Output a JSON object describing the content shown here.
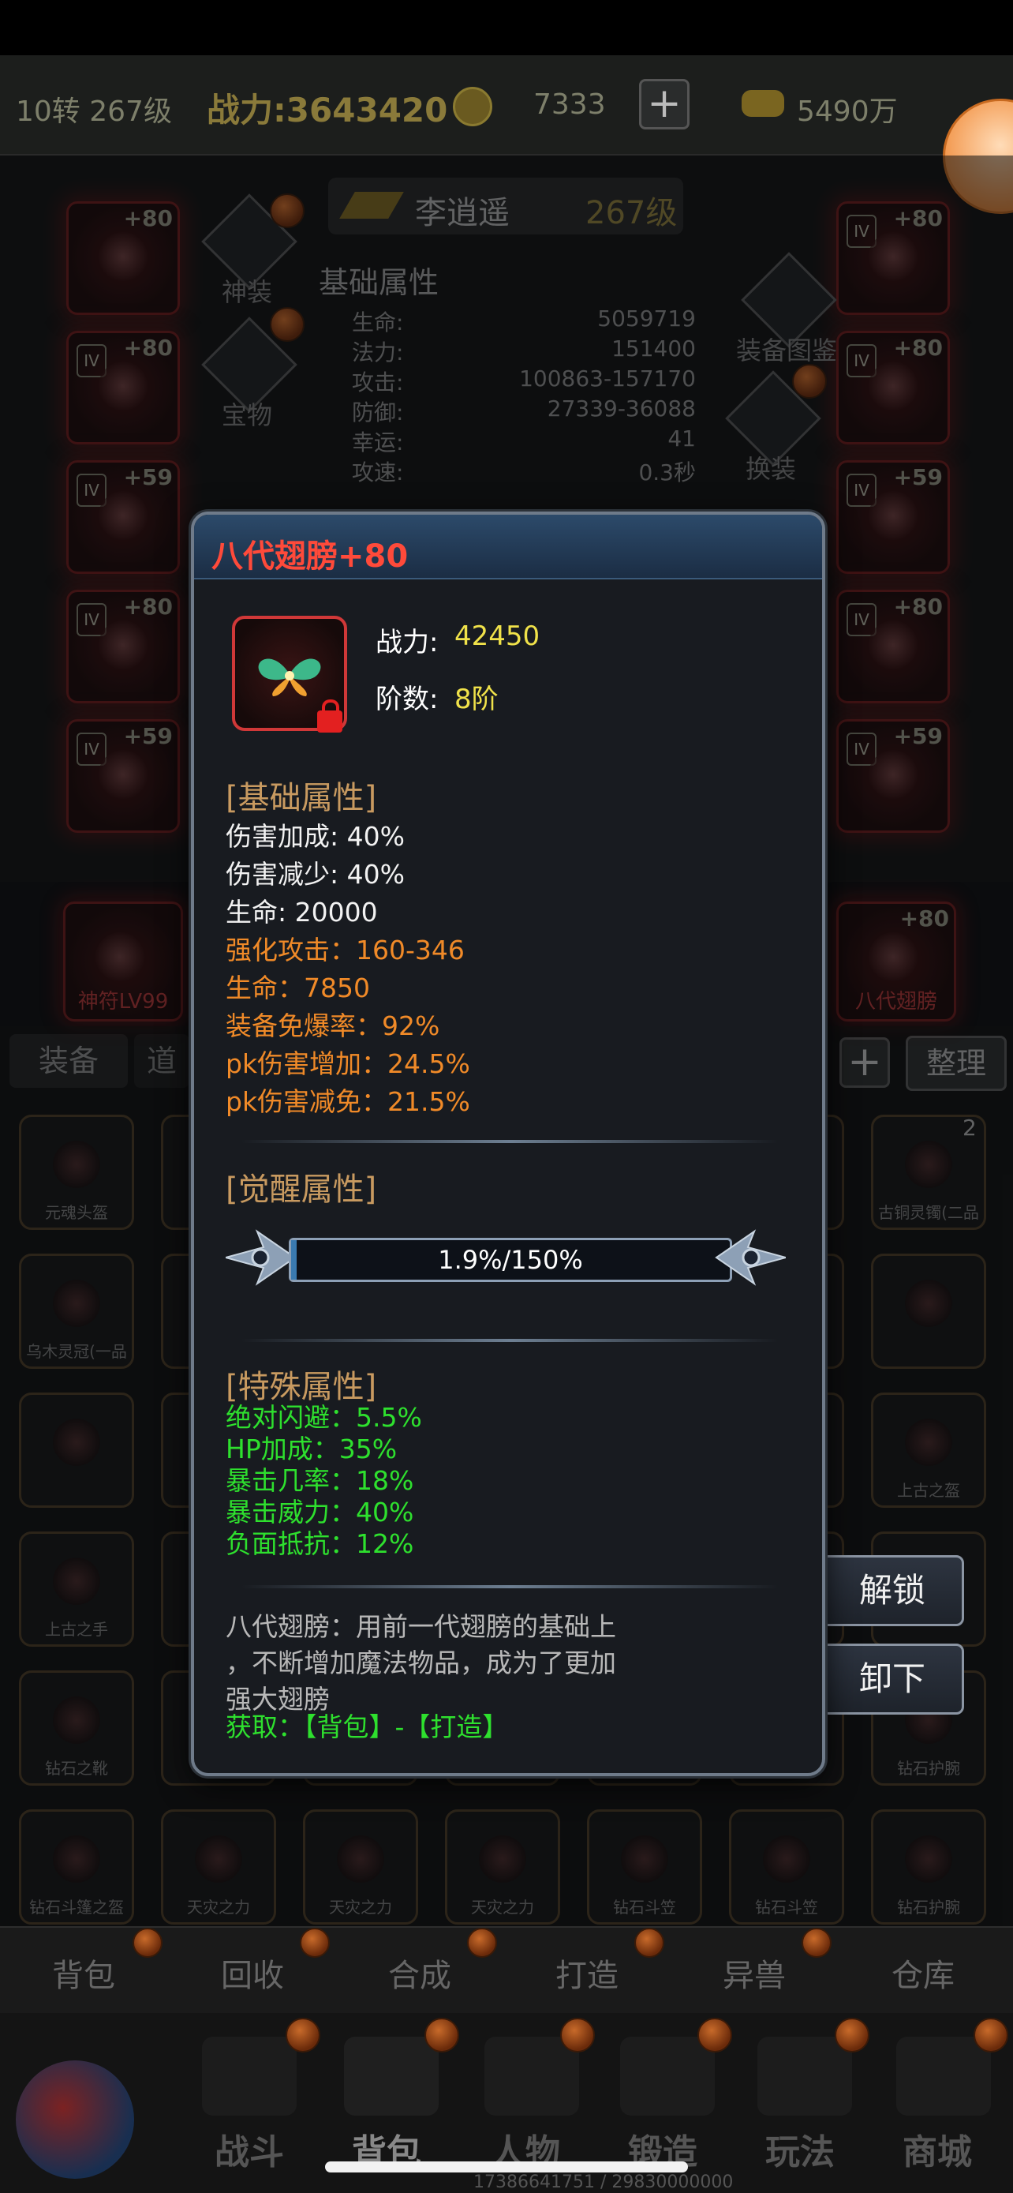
{
  "topbar": {
    "reincarnation": "10转 267级",
    "combat_power": "战力:3643420",
    "coins": "7333",
    "ingots": "5490万"
  },
  "character": {
    "name": "李逍遥",
    "level": "267级",
    "stats_title": "基础属性",
    "stats": [
      {
        "label": "生命:",
        "value": "5059719"
      },
      {
        "label": "法力:",
        "value": "151400"
      },
      {
        "label": "攻击:",
        "value": "100863-157170"
      },
      {
        "label": "防御:",
        "value": "27339-36088"
      },
      {
        "label": "幸运:",
        "value": "41"
      },
      {
        "label": "攻速:",
        "value": "0.3秒"
      }
    ]
  },
  "left_icons": [
    {
      "label": "神装"
    },
    {
      "label": "宝物"
    }
  ],
  "right_icons": [
    {
      "label": "装备图鉴"
    },
    {
      "label": "换装"
    }
  ],
  "equip_left": [
    "+80",
    "+80",
    "+59",
    "+80",
    "+59"
  ],
  "equip_right": [
    "+80",
    "+80",
    "+59",
    "+80",
    "+59"
  ],
  "special_slots": {
    "left_label": "神符LV99",
    "right_label": "八代翅膀",
    "right_level": "+80"
  },
  "inventory_tabs": {
    "equip": "装备",
    "items": "道",
    "sort": "整理"
  },
  "inventory_items": [
    "元魂头盔",
    "",
    "",
    "",
    "",
    "",
    "古铜灵镯(二品",
    "乌木灵冠(一品",
    "古",
    "",
    "",
    "",
    "",
    "",
    "",
    "",
    "",
    "",
    "",
    "",
    "上古之盔",
    "上古之手",
    "",
    "",
    "",
    "",
    "",
    "",
    "钻石之靴",
    "",
    "",
    "",
    "",
    "",
    "钻石护腕",
    "钻石斗篷之盔",
    "天灾之力",
    "天灾之力",
    "天灾之力",
    "钻石斗笠",
    "钻石斗笠",
    "钻石护腕"
  ],
  "inventory_count": "2",
  "bottom_tabs": [
    "背包",
    "回收",
    "合成",
    "打造",
    "异兽",
    "仓库"
  ],
  "nav": [
    "战斗",
    "背包",
    "人物",
    "锻造",
    "玩法",
    "商城"
  ],
  "footer": "17386641751 / 29830000000",
  "popup": {
    "title": "八代翅膀+80",
    "power_label": "战力:",
    "power_value": "42450",
    "tier_label": "阶数:",
    "tier_value": "8阶",
    "base_title": "[基础属性]",
    "base_white": [
      "伤害加成: 40%",
      "伤害减少: 40%",
      "生命: 20000"
    ],
    "base_orange": [
      "强化攻击：160-346",
      "生命：7850",
      "装备免爆率：92%",
      "pk伤害增加：24.5%",
      "pk伤害减免：21.5%"
    ],
    "awaken_title": "[觉醒属性]",
    "awaken_progress": "1.9%/150%",
    "awaken_fraction": 0.0127,
    "special_title": "[特殊属性]",
    "special": [
      "绝对闪避：5.5%",
      "HP加成：35%",
      "暴击几率：18%",
      "暴击威力：40%",
      "负面抵抗：12%"
    ],
    "desc_lines": [
      "八代翅膀：用前一代翅膀的基础上",
      "，不断增加魔法物品，成为了更加",
      "强大翅膀"
    ],
    "source": "获取：【背包】-【打造】"
  },
  "side_buttons": {
    "unlock": "解锁",
    "unequip": "卸下"
  },
  "colors": {
    "title_red": "#ff4a3a",
    "value_yellow": "#f0e24a",
    "orange_stat": "#f08a28",
    "green_stat": "#2ee02e",
    "section_gold": "#c89a60"
  }
}
